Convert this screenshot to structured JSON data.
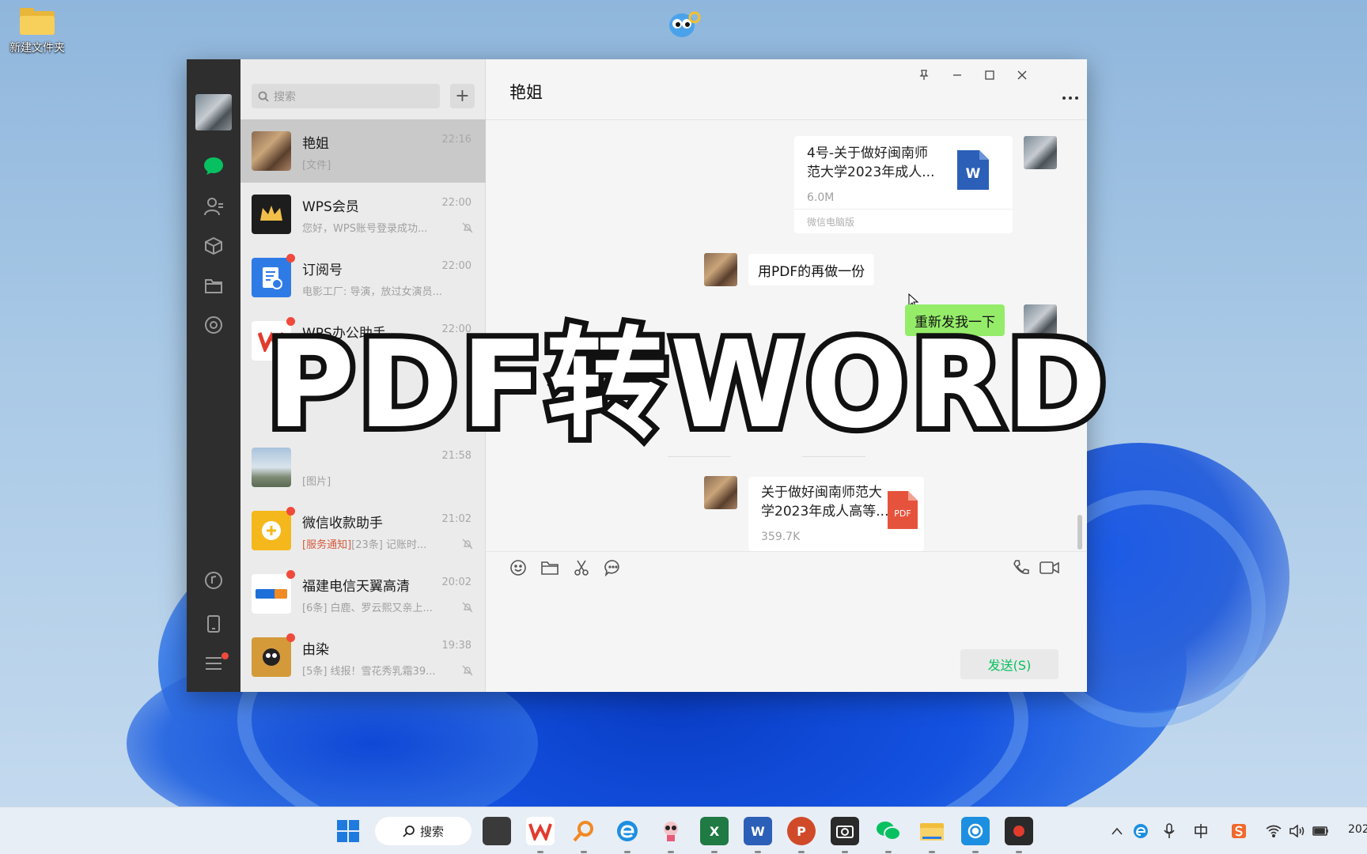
{
  "desktop": {
    "icon_label": "新建文件夹"
  },
  "overlay": {
    "title": "PDF转WORD"
  },
  "window": {
    "search": {
      "placeholder": "搜索"
    },
    "add_label": "+",
    "chats": [
      {
        "name": "艳姐",
        "time": "22:16",
        "preview": "[文件]",
        "active": true
      },
      {
        "name": "WPS会员",
        "time": "22:00",
        "preview": "您好，WPS账号登录成功..."
      },
      {
        "name": "订阅号",
        "time": "22:00",
        "preview": "电影工厂: 导演，放过女演员..."
      },
      {
        "name": "WPS办公助手",
        "time": "22:00",
        "preview": ""
      },
      {
        "name": "",
        "time": "21:58",
        "preview": "[图片]"
      },
      {
        "name": "微信收款助手",
        "time": "21:02",
        "preview_tag": "[服务通知]",
        "preview": "[23条] 记账时..."
      },
      {
        "name": "福建电信天翼高清",
        "time": "20:02",
        "preview": "[6条] 白鹿、罗云熙又亲上..."
      },
      {
        "name": "由染",
        "time": "19:38",
        "preview": "[5条] 线报！雪花秀乳霜39..."
      }
    ],
    "chat": {
      "title": "艳姐",
      "messages": {
        "word_file": {
          "name_line1": "4号-关于做好闽南师",
          "name_line2": "范大学2023年成人...",
          "size": "6.0M",
          "source": "微信电脑版",
          "icon_label": "W"
        },
        "incoming_text": "用PDF的再做一份",
        "outgoing_text": "重新发我一下",
        "pdf_file": {
          "name_line1": "关于做好闽南师范大",
          "name_line2": "学2023年成人高等...",
          "size": "359.7K",
          "icon_label": "PDF"
        }
      },
      "send_label": "发送(S)"
    }
  },
  "taskbar": {
    "search_label": "搜索",
    "clock": "202"
  }
}
